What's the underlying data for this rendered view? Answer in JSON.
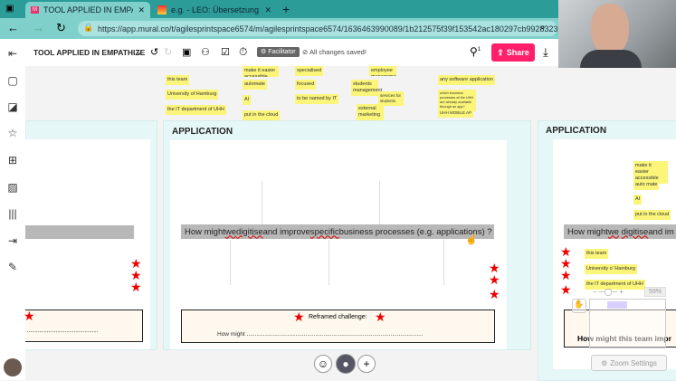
{
  "browser": {
    "tabs": [
      {
        "title": "TOOL APPLIED IN EMPATHIZE • /",
        "icon": "mural-icon"
      },
      {
        "title": "e.g. - LEO: Übersetzung im Engli",
        "icon": "leo-icon"
      }
    ],
    "url": "https://app.mural.co/t/agilesprintspace6574/m/agilesprintspace6574/1636463990089/1b212575f39f153542ac180297cb99283236c..."
  },
  "toolbar": {
    "board_title": "TOOL APPLIED IN EMPATHIZE",
    "facilitator": "Facilitator",
    "status": "All changes saved!",
    "user_count": "1",
    "share": "Share"
  },
  "top_notes": [
    "this team",
    "University of Hamburg",
    "the IT department of UHH",
    "make it easier accessible",
    "automate",
    "AI",
    "put in the cloud",
    "specialised",
    "focused",
    "to be named by IT",
    "employee management",
    "students management",
    "services for students",
    "external marketing",
    "any software application",
    "which business processes at the UHH are already available through an app?",
    "UHH MOBILE AP"
  ],
  "frames": {
    "center": {
      "title": "APPLICATION",
      "question": [
        "How might ",
        "we",
        " ",
        "digitise",
        " and improve ",
        "specific",
        " business processes (e.g. applications) ?"
      ],
      "reframed_label": "Reframed challenge:",
      "how_might": "How might ............................................................................................................"
    },
    "right": {
      "title": "APPLICATION",
      "question_start": "How might ",
      "we": "we",
      "digitise": "digitise",
      "question_end": " and im",
      "notes_top": [
        "make it easier accessible",
        "auto mate",
        "AI",
        "put in the cloud"
      ],
      "notes_bottom": [
        "this team",
        "University o' Hamburg",
        "the IT department of UHH"
      ],
      "how_might": "How might this team impr"
    },
    "left": {
      "how_might": "..............................................."
    }
  },
  "zoom": {
    "level": "59%",
    "settings": "Zoom Settings"
  },
  "colors": {
    "accent": "#ff1f6b",
    "sticky": "#fbf57a",
    "star": "#e00000"
  }
}
